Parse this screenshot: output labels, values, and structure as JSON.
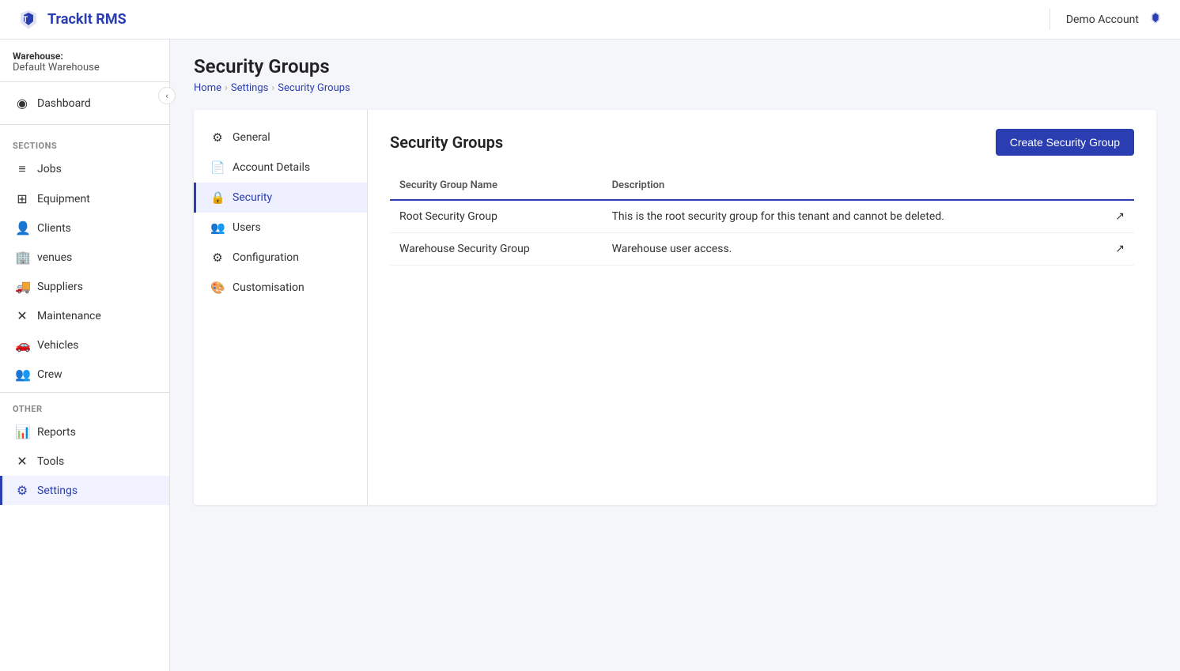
{
  "app": {
    "name": "TrackIt RMS"
  },
  "account": {
    "name": "Demo Account"
  },
  "warehouse": {
    "label": "Warehouse:",
    "name": "Default Warehouse"
  },
  "sidebar": {
    "dashboard_label": "Dashboard",
    "sections": [
      {
        "label": "SECTIONS",
        "items": [
          {
            "id": "jobs",
            "label": "Jobs",
            "icon": "≡"
          },
          {
            "id": "equipment",
            "label": "Equipment",
            "icon": "🏗"
          },
          {
            "id": "clients",
            "label": "Clients",
            "icon": "👥"
          },
          {
            "id": "venues",
            "label": "venues",
            "icon": "🏢"
          },
          {
            "id": "suppliers",
            "label": "Suppliers",
            "icon": "🚚"
          },
          {
            "id": "maintenance",
            "label": "Maintenance",
            "icon": "🔧"
          },
          {
            "id": "vehicles",
            "label": "Vehicles",
            "icon": "🚗"
          },
          {
            "id": "crew",
            "label": "Crew",
            "icon": "👥"
          }
        ]
      },
      {
        "label": "OTHER",
        "items": [
          {
            "id": "reports",
            "label": "Reports",
            "icon": "📊"
          },
          {
            "id": "tools",
            "label": "Tools",
            "icon": "🔧"
          },
          {
            "id": "settings",
            "label": "Settings",
            "icon": "⚙",
            "active": true
          }
        ]
      }
    ]
  },
  "breadcrumb": {
    "items": [
      {
        "label": "Home",
        "link": true
      },
      {
        "label": "Settings",
        "link": true
      },
      {
        "label": "Security Groups",
        "link": true
      }
    ]
  },
  "page": {
    "title": "Security Groups"
  },
  "sub_nav": {
    "items": [
      {
        "id": "general",
        "label": "General",
        "icon": "⚙"
      },
      {
        "id": "account-details",
        "label": "Account Details",
        "icon": "📄"
      },
      {
        "id": "security",
        "label": "Security",
        "icon": "🔒",
        "active": true
      },
      {
        "id": "users",
        "label": "Users",
        "icon": "👥"
      },
      {
        "id": "configuration",
        "label": "Configuration",
        "icon": "⚙"
      },
      {
        "id": "customisation",
        "label": "Customisation",
        "icon": "🎨"
      }
    ]
  },
  "panel": {
    "title": "Security Groups",
    "create_button_label": "Create Security Group",
    "table": {
      "columns": [
        {
          "id": "name",
          "label": "Security Group Name"
        },
        {
          "id": "description",
          "label": "Description"
        }
      ],
      "rows": [
        {
          "name": "Root Security Group",
          "description": "This is the root security group for this tenant and cannot be deleted."
        },
        {
          "name": "Warehouse Security Group",
          "description": "Warehouse user access."
        }
      ]
    }
  }
}
